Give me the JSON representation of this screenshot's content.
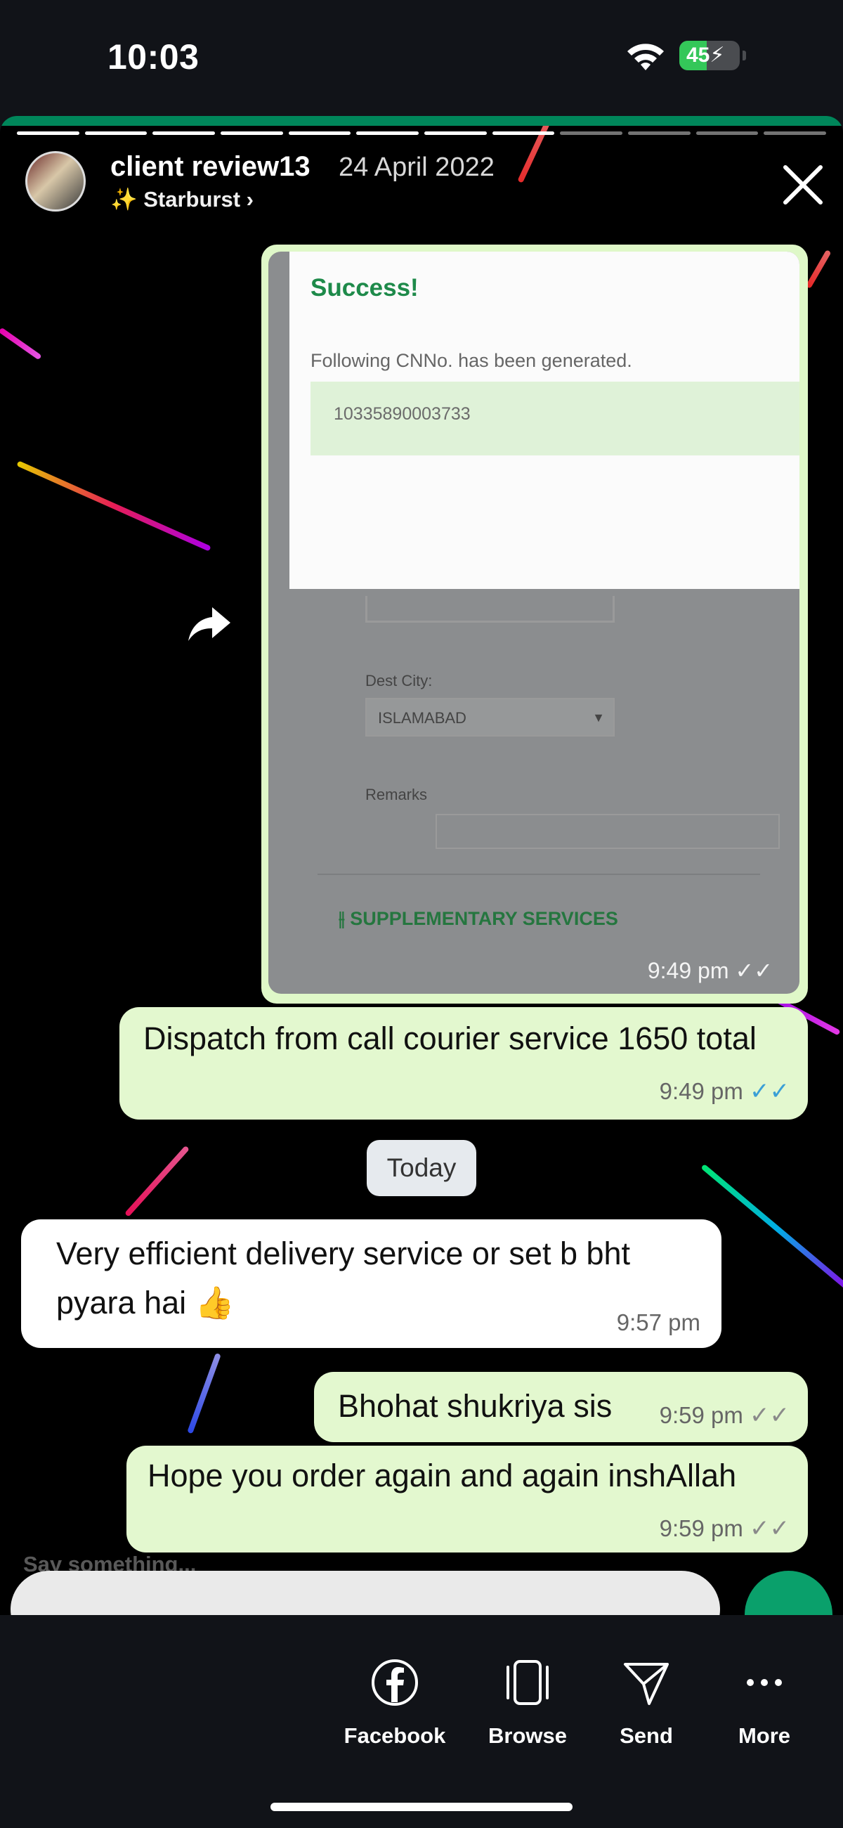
{
  "status_bar": {
    "time": "10:03",
    "battery_level": "45",
    "battery_fraction": 0.45
  },
  "story": {
    "username": "client review13",
    "date": "24 April 2022",
    "filter_label": "✨ Starburst ›"
  },
  "chat": {
    "image_message": {
      "success_title": "Success!",
      "cn_label": "Following CNNo. has been generated.",
      "cn_number": "10335890003733",
      "dest_city_label": "Dest City:",
      "dest_city_value": "ISLAMABAD",
      "remarks_label": "Remarks",
      "supplementary_label": "⫲ SUPPLEMENTARY SERVICES",
      "time": "9:49 pm ✓✓"
    },
    "messages": [
      {
        "text": "Dispatch from call courier service 1650 total",
        "time": "9:49 pm",
        "ticks": "✓✓"
      },
      {
        "text": "Very efficient delivery service or set b bht pyara hai 👍",
        "time": "9:57 pm"
      },
      {
        "text": "Bhohat shukriya sis",
        "time": "9:59 pm",
        "ticks": "✓✓"
      },
      {
        "text": "Hope you order again and again inshAllah",
        "time": "9:59 pm",
        "ticks": "✓✓"
      }
    ],
    "date_divider": "Today"
  },
  "reply": {
    "placeholder": "Say something..."
  },
  "actions": [
    {
      "label": "Facebook",
      "icon": "facebook-icon"
    },
    {
      "label": "Browse",
      "icon": "browse-icon"
    },
    {
      "label": "Send",
      "icon": "send-icon"
    },
    {
      "label": "More",
      "icon": "more-icon"
    }
  ],
  "colors": {
    "whatsapp_green": "#00865a",
    "outgoing_bubble": "#e3f8cf",
    "read_tick": "#3a9fd6"
  }
}
